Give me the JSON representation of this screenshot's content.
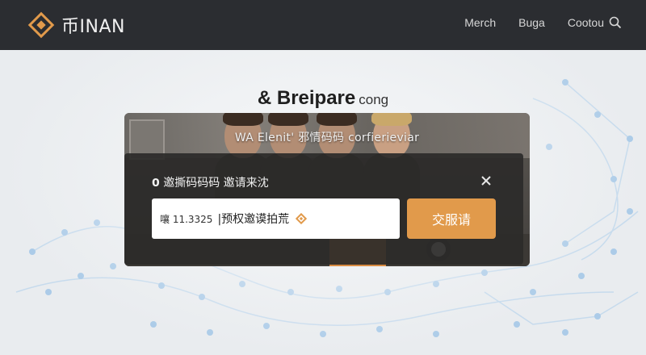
{
  "header": {
    "brand_name": "币INAN",
    "nav": [
      "Merch",
      "Buga",
      "Cootou"
    ],
    "accent": "#e19a4b"
  },
  "hero": {
    "title": "& Breipare",
    "title_suffix": "cong",
    "photo_caption": "WA Elenit'  邪情码码  corfierieviar"
  },
  "dialog": {
    "title": "𝟬 邀撕码码码 邀请来沈",
    "input_prefix": "嚷 11.3325",
    "input_value": "|预权邀谟拍荒",
    "confirm_label": "交服请",
    "icons": [
      "close-icon",
      "diamond-icon"
    ]
  }
}
